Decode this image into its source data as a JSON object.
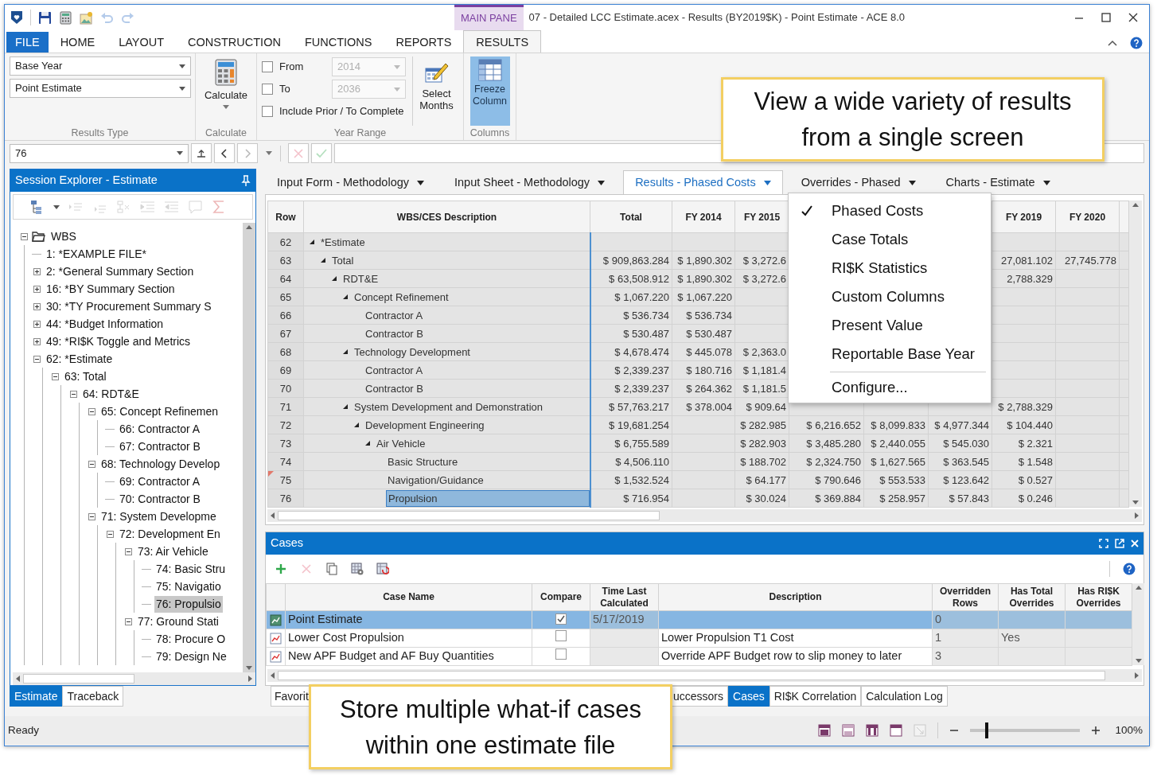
{
  "title_bar": {
    "quick_access": [
      {
        "kind": "save",
        "disabled": false
      },
      {
        "kind": "calculator",
        "disabled": false
      },
      {
        "kind": "export",
        "disabled": false
      },
      {
        "kind": "undo",
        "disabled": true
      },
      {
        "kind": "redo",
        "disabled": true
      }
    ],
    "context_tab": "MAIN PANE",
    "title": "07 - Detailed LCC Estimate.acex - Results (BY2019$K) - Point Estimate - ACE 8.0"
  },
  "ribbon_tabs": [
    {
      "label": "FILE",
      "kind": "file",
      "selected": false
    },
    {
      "label": "HOME",
      "kind": "tab",
      "selected": false
    },
    {
      "label": "LAYOUT",
      "kind": "tab",
      "selected": false
    },
    {
      "label": "CONSTRUCTION",
      "kind": "tab",
      "selected": false
    },
    {
      "label": "FUNCTIONS",
      "kind": "tab",
      "selected": false
    },
    {
      "label": "REPORTS",
      "kind": "tab",
      "selected": false
    },
    {
      "label": "RESULTS",
      "kind": "tab",
      "selected": true
    }
  ],
  "ribbon": {
    "results_type": {
      "dropdowns": [
        "Base Year",
        "Point Estimate"
      ],
      "label": "Results Type"
    },
    "calculate": {
      "button": "Calculate",
      "label": "Calculate"
    },
    "year_range": {
      "options": [
        {
          "label": "From",
          "checked": false,
          "value": "2014",
          "disabled": true
        },
        {
          "label": "To",
          "checked": false,
          "value": "2036",
          "disabled": true
        },
        {
          "label": "Include Prior / To Complete",
          "checked": false
        }
      ],
      "select_months": "Select Months",
      "label": "Year Range"
    },
    "columns": {
      "button": "Freeze Column",
      "on": true,
      "label": "Columns"
    }
  },
  "formula_bar": {
    "cell": "76",
    "buttons": [
      {
        "kind": "up",
        "disabled": false
      },
      {
        "kind": "back",
        "disabled": false
      },
      {
        "kind": "forward",
        "disabled": true
      },
      {
        "kind": "cancel",
        "disabled": true
      },
      {
        "kind": "confirm",
        "disabled": true
      }
    ]
  },
  "session_explorer": {
    "title": "Session Explorer - Estimate",
    "tools": [
      {
        "kind": "hierarchy",
        "disabled": false
      },
      {
        "kind": "promote",
        "disabled": true
      },
      {
        "kind": "demote",
        "disabled": true
      },
      {
        "kind": "delete",
        "disabled": true
      },
      {
        "kind": "indent",
        "disabled": true
      },
      {
        "kind": "outdent",
        "disabled": true
      },
      {
        "kind": "comment",
        "disabled": true
      },
      {
        "kind": "sum",
        "disabled": true
      }
    ],
    "tree": [
      {
        "label": "WBS",
        "expanded": true,
        "selected": false,
        "children": [
          {
            "label": "1: *EXAMPLE FILE*",
            "selected": false
          },
          {
            "label": "2: *General Summary Section",
            "expanded": false,
            "selected": false
          },
          {
            "label": "16: *BY Summary Section",
            "expanded": false,
            "selected": false
          },
          {
            "label": "30: *TY Procurement Summary S",
            "expanded": false,
            "selected": false
          },
          {
            "label": "44: *Budget Information",
            "expanded": false,
            "selected": false
          },
          {
            "label": "49: *RI$K Toggle and Metrics",
            "expanded": false,
            "selected": false
          },
          {
            "label": "62: *Estimate",
            "expanded": true,
            "selected": false,
            "children": [
              {
                "label": "63: Total",
                "expanded": true,
                "selected": false,
                "children": [
                  {
                    "label": "64: RDT&E",
                    "expanded": true,
                    "selected": false,
                    "children": [
                      {
                        "label": "65: Concept Refinemen",
                        "expanded": true,
                        "selected": false,
                        "children": [
                          {
                            "label": "66: Contractor A",
                            "selected": false
                          },
                          {
                            "label": "67: Contractor B",
                            "selected": false
                          }
                        ]
                      },
                      {
                        "label": "68: Technology Develop",
                        "expanded": true,
                        "selected": false,
                        "children": [
                          {
                            "label": "69: Contractor A",
                            "selected": false
                          },
                          {
                            "label": "70: Contractor B",
                            "selected": false
                          }
                        ]
                      },
                      {
                        "label": "71: System Developme",
                        "expanded": true,
                        "selected": false,
                        "children": [
                          {
                            "label": "72: Development En",
                            "expanded": true,
                            "selected": false,
                            "children": [
                              {
                                "label": "73: Air Vehicle",
                                "expanded": true,
                                "selected": false,
                                "children": [
                                  {
                                    "label": "74: Basic Stru",
                                    "selected": false
                                  },
                                  {
                                    "label": "75: Navigatio",
                                    "selected": false
                                  },
                                  {
                                    "label": "76: Propulsio",
                                    "selected": true
                                  }
                                ]
                              },
                              {
                                "label": "77: Ground Stati",
                                "expanded": true,
                                "selected": false,
                                "children": [
                                  {
                                    "label": "78: Procure O",
                                    "selected": false
                                  },
                                  {
                                    "label": "79: Design Ne",
                                    "selected": false
                                  }
                                ]
                              }
                            ]
                          }
                        ]
                      }
                    ]
                  }
                ]
              }
            ]
          }
        ]
      }
    ],
    "tabs": [
      {
        "label": "Estimate",
        "selected": true
      },
      {
        "label": "Traceback",
        "selected": false
      }
    ]
  },
  "document_tabs": [
    {
      "label": "Input Form - Methodology",
      "selected": false
    },
    {
      "label": "Input Sheet - Methodology",
      "selected": false
    },
    {
      "label": "Results - Phased Costs",
      "selected": true
    },
    {
      "label": "Overrides - Phased",
      "selected": false
    },
    {
      "label": "Charts - Estimate",
      "selected": false
    }
  ],
  "results_grid": {
    "columns": [
      {
        "kind": "header",
        "label": "Row"
      },
      {
        "kind": "header",
        "label": "WBS/CES Description"
      },
      {
        "kind": "header",
        "label": "Total"
      },
      {
        "kind": "header",
        "label": "FY 2014"
      },
      {
        "kind": "header",
        "label": "FY 2015"
      },
      {
        "kind": "covered"
      },
      {
        "kind": "covered"
      },
      {
        "kind": "covered"
      },
      {
        "kind": "header",
        "label": "FY 2019"
      },
      {
        "kind": "header",
        "label": "FY 2020"
      }
    ],
    "rows": [
      {
        "row": "62",
        "description": "*Estimate",
        "expanded": true,
        "comment": false,
        "selected": false,
        "cells": [
          null,
          null,
          null,
          null,
          null,
          null,
          null,
          null
        ],
        "children": [
          {
            "row": "63",
            "description": "Total",
            "expanded": true,
            "comment": false,
            "selected": false,
            "cells": [
              "$ 909,863.284",
              "$ 1,890.302",
              "$ 3,272.6",
              null,
              null,
              null,
              "27,081.102",
              "27,745.778"
            ],
            "children": [
              {
                "row": "64",
                "description": "RDT&E",
                "expanded": true,
                "comment": false,
                "selected": false,
                "cells": [
                  "$ 63,508.912",
                  "$ 1,890.302",
                  "$ 3,272.6",
                  null,
                  null,
                  null,
                  "2,788.329",
                  null
                ],
                "children": [
                  {
                    "row": "65",
                    "description": "Concept Refinement",
                    "expanded": true,
                    "comment": false,
                    "selected": false,
                    "cells": [
                      "$ 1,067.220",
                      "$ 1,067.220",
                      null,
                      null,
                      null,
                      null,
                      null,
                      null
                    ],
                    "children": [
                      {
                        "row": "66",
                        "description": "Contractor A",
                        "comment": false,
                        "selected": false,
                        "cells": [
                          "$ 536.734",
                          "$ 536.734",
                          null,
                          null,
                          null,
                          null,
                          null,
                          null
                        ]
                      },
                      {
                        "row": "67",
                        "description": "Contractor B",
                        "comment": false,
                        "selected": false,
                        "cells": [
                          "$ 530.487",
                          "$ 530.487",
                          null,
                          null,
                          null,
                          null,
                          null,
                          null
                        ]
                      }
                    ]
                  },
                  {
                    "row": "68",
                    "description": "Technology Development",
                    "expanded": true,
                    "comment": false,
                    "selected": false,
                    "cells": [
                      "$ 4,678.474",
                      "$ 445.078",
                      "$ 2,363.0",
                      null,
                      null,
                      null,
                      null,
                      null
                    ],
                    "children": [
                      {
                        "row": "69",
                        "description": "Contractor A",
                        "comment": false,
                        "selected": false,
                        "cells": [
                          "$ 2,339.237",
                          "$ 180.716",
                          "$ 1,181.4",
                          null,
                          null,
                          null,
                          null,
                          null
                        ]
                      },
                      {
                        "row": "70",
                        "description": "Contractor B",
                        "comment": false,
                        "selected": false,
                        "cells": [
                          "$ 2,339.237",
                          "$ 264.362",
                          "$ 1,181.5",
                          null,
                          null,
                          null,
                          null,
                          null
                        ]
                      }
                    ]
                  },
                  {
                    "row": "71",
                    "description": "System Development and Demonstration",
                    "expanded": true,
                    "comment": false,
                    "selected": false,
                    "cells": [
                      "$ 57,763.217",
                      "$ 378.004",
                      "$ 909.64",
                      null,
                      null,
                      null,
                      "$ 2,788.329",
                      null
                    ],
                    "children": [
                      {
                        "row": "72",
                        "description": "Development Engineering",
                        "expanded": true,
                        "comment": false,
                        "selected": false,
                        "cells": [
                          "$ 19,681.254",
                          null,
                          "$ 282.985",
                          "$ 6,216.652",
                          "$ 8,099.833",
                          "$ 4,977.344",
                          "$ 104.440",
                          null
                        ],
                        "children": [
                          {
                            "row": "73",
                            "description": "Air Vehicle",
                            "expanded": true,
                            "comment": false,
                            "selected": false,
                            "cells": [
                              "$ 6,755.589",
                              null,
                              "$ 282.903",
                              "$ 3,485.280",
                              "$ 2,440.055",
                              "$ 545.030",
                              "$ 2.321",
                              null
                            ],
                            "children": [
                              {
                                "row": "74",
                                "description": "Basic Structure",
                                "comment": false,
                                "selected": false,
                                "cells": [
                                  "$ 4,506.110",
                                  null,
                                  "$ 188.702",
                                  "$ 2,324.750",
                                  "$ 1,627.565",
                                  "$ 363.545",
                                  "$ 1.548",
                                  null
                                ]
                              },
                              {
                                "row": "75",
                                "description": "Navigation/Guidance",
                                "comment": true,
                                "selected": false,
                                "cells": [
                                  "$ 1,532.524",
                                  null,
                                  "$ 64.177",
                                  "$ 790.646",
                                  "$ 553.533",
                                  "$ 123.642",
                                  "$ 0.527",
                                  null
                                ]
                              },
                              {
                                "row": "76",
                                "description": "Propulsion",
                                "comment": false,
                                "selected": true,
                                "cells": [
                                  "$ 716.954",
                                  null,
                                  "$ 30.024",
                                  "$ 369.884",
                                  "$ 258.957",
                                  "$ 57.843",
                                  "$ 0.246",
                                  null
                                ]
                              }
                            ]
                          }
                        ]
                      }
                    ]
                  }
                ]
              }
            ]
          }
        ]
      }
    ]
  },
  "results_menu": {
    "items": [
      {
        "label": "Phased Costs",
        "checked": true
      },
      {
        "label": "Case Totals",
        "checked": false
      },
      {
        "label": "RI$K Statistics",
        "checked": false
      },
      {
        "label": "Custom Columns",
        "checked": false
      },
      {
        "label": "Present Value",
        "checked": false
      },
      {
        "label": "Reportable Base Year",
        "checked": false
      }
    ],
    "configure": "Configure..."
  },
  "cases": {
    "title": "Cases",
    "tools": [
      {
        "kind": "add",
        "disabled": false
      },
      {
        "kind": "delete",
        "disabled": true
      },
      {
        "kind": "copy",
        "disabled": false
      },
      {
        "kind": "settings",
        "disabled": false
      },
      {
        "kind": "refresh",
        "disabled": false
      }
    ],
    "columns": [
      {
        "label": "Case Name",
        "readonly": false
      },
      {
        "label": "Compare",
        "readonly": false
      },
      {
        "label": "Time Last Calculated",
        "readonly": true
      },
      {
        "label": "Description",
        "readonly": false
      },
      {
        "label": "Overridden Rows",
        "readonly": true
      },
      {
        "label": "Has Total Overrides",
        "readonly": true
      },
      {
        "label": "Has RI$K Overrides",
        "readonly": true
      }
    ],
    "rows": [
      {
        "kind": "baseline",
        "name": "Point Estimate",
        "compare": true,
        "time": "5/17/2019",
        "overridden_rows": "0",
        "selected": true
      },
      {
        "kind": "alternate",
        "name": "Lower Cost Propulsion",
        "compare": false,
        "description": "Lower Propulsion T1 Cost",
        "overridden_rows": "1",
        "has_total_overrides": "Yes",
        "selected": false
      },
      {
        "kind": "alternate",
        "name": "New APF Budget and AF Buy Quantities",
        "compare": false,
        "description": "Override APF Budget row to slip money to later",
        "overridden_rows": "3",
        "selected": false
      }
    ]
  },
  "bottom_tabs": [
    {
      "label": "Favorit",
      "selected": false
    },
    {
      "label": "uccessors",
      "selected": false
    },
    {
      "label": "Cases",
      "selected": true
    },
    {
      "label": "RI$K Correlation",
      "selected": false
    },
    {
      "label": "Calculation Log",
      "selected": false
    }
  ],
  "status_bar": {
    "text": "Ready",
    "views": [
      {
        "disabled": false
      },
      {
        "disabled": false
      },
      {
        "disabled": false
      },
      {
        "disabled": false
      },
      {
        "disabled": true
      }
    ],
    "zoom": {
      "level": 0.15,
      "reading": "100%"
    }
  },
  "callouts": [
    {
      "lines": [
        "View a wide variety of results",
        "from a single screen"
      ]
    },
    {
      "lines": [
        "Store multiple what-if cases",
        "within one estimate file"
      ]
    }
  ]
}
